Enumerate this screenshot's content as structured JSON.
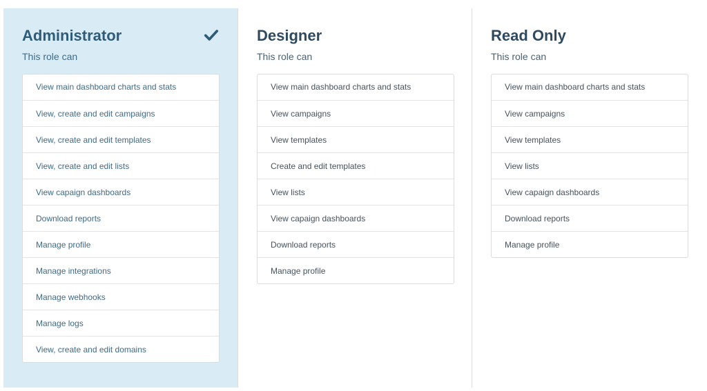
{
  "roles": [
    {
      "title": "Administrator",
      "subtitle": "This role can",
      "selected": true,
      "permissions": [
        "View main dashboard charts and stats",
        "View, create and edit campaigns",
        "View, create and edit templates",
        "View, create and edit lists",
        "View capaign dashboards",
        "Download reports",
        "Manage profile",
        "Manage integrations",
        "Manage webhooks",
        "Manage logs",
        "View, create and edit domains"
      ]
    },
    {
      "title": "Designer",
      "subtitle": "This role can",
      "selected": false,
      "permissions": [
        "View main dashboard charts and stats",
        "View campaigns",
        "View templates",
        "Create and edit templates",
        "View lists",
        "View capaign dashboards",
        "Download reports",
        "Manage profile"
      ]
    },
    {
      "title": "Read Only",
      "subtitle": "This role can",
      "selected": false,
      "permissions": [
        "View main dashboard charts and stats",
        "View campaigns",
        "View templates",
        "View lists",
        "View capaign dashboards",
        "Download reports",
        "Manage profile"
      ]
    }
  ],
  "colors": {
    "selected_background": "#d9ecf5",
    "check_color": "#2d5b78"
  },
  "icons": {
    "selected_marker": "check-icon"
  }
}
